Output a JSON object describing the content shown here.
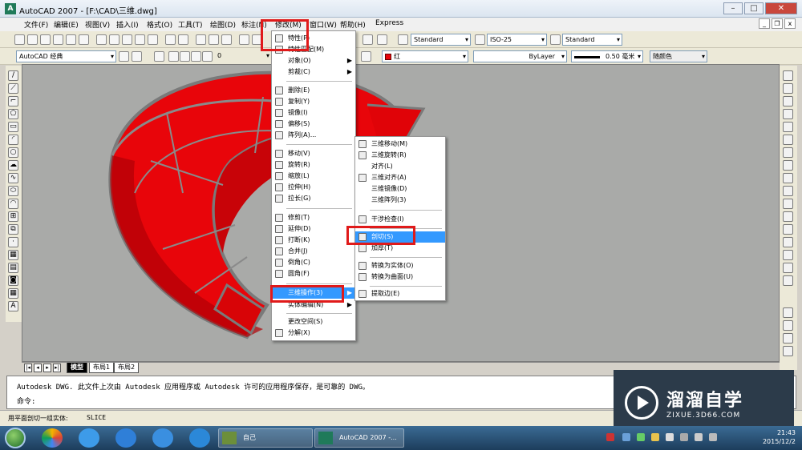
{
  "window": {
    "title": "AutoCAD 2007 - [F:\\CAD\\三维.dwg]",
    "icon": "autocad-app-icon",
    "controls": [
      "–",
      "□",
      "✕"
    ]
  },
  "menubar": {
    "items": [
      "文件(F)",
      "编辑(E)",
      "视图(V)",
      "插入(I)",
      "格式(O)",
      "工具(T)",
      "绘图(D)",
      "标注(N)",
      "修改(M)",
      "窗口(W)",
      "帮助(H)",
      "Express"
    ]
  },
  "toolbar": {
    "text_style": "Standard",
    "dim_style": "ISO-25",
    "table_style": "Standard",
    "workspace": "AutoCAD 经典",
    "layer": "0",
    "color": "红",
    "linetype": "ByLayer",
    "lineweight": "0.50 毫米",
    "plotstyle": "随颜色"
  },
  "modify_menu": {
    "items": [
      "特性(P)",
      "特性匹配(M)",
      "对象(O)",
      "剪裁(C)",
      "删除(E)",
      "复制(Y)",
      "镜像(I)",
      "偏移(S)",
      "阵列(A)...",
      "移动(V)",
      "旋转(R)",
      "缩放(L)",
      "拉伸(H)",
      "拉长(G)",
      "修剪(T)",
      "延伸(D)",
      "打断(K)",
      "合并(J)",
      "倒角(C)",
      "圆角(F)",
      "三维操作(3)",
      "实体编辑(N)",
      "更改空间(S)",
      "分解(X)"
    ],
    "highlighted": "三维操作(3)"
  },
  "ops3d_menu": {
    "items": [
      "三维移动(M)",
      "三维旋转(R)",
      "对齐(L)",
      "三维对齐(A)",
      "三维镜像(D)",
      "三维阵列(3)",
      "干涉检查(I)",
      "剖切(S)",
      "加厚(T)",
      "转换为实体(O)",
      "转换为曲面(U)",
      "提取边(E)"
    ],
    "highlighted": "剖切(S)"
  },
  "layout_tabs": [
    "模型",
    "布局1",
    "布局2"
  ],
  "command_line": {
    "history": "Autodesk DWG.   此文件上次由 Autodesk 应用程序或 Autodesk 许可的应用程序保存，是可靠的 DWG。",
    "prompt": "命令:"
  },
  "status_bar": {
    "hint": "用平面剖切一组实体:",
    "command": "SLICE"
  },
  "watermark": {
    "title": "溜溜自学",
    "url": "ZIXUE.3D66.COM"
  },
  "taskbar": {
    "buttons": [
      "自己",
      "AutoCAD 2007 -..."
    ],
    "time": "21:43",
    "date": "2015/12/2"
  },
  "colors": {
    "solid_red": "#e8050a",
    "canvas": "#a9aaa8",
    "highlight": "#3399ff",
    "callout": "#e01a1a"
  }
}
